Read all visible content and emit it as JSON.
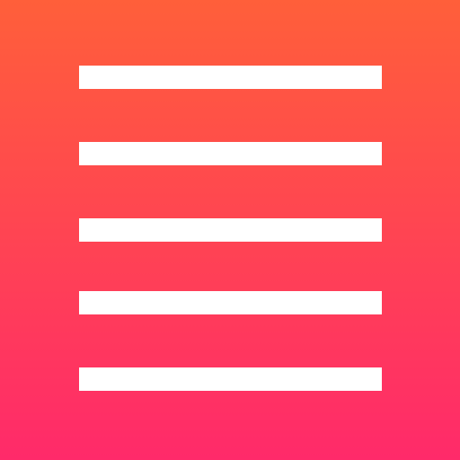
{
  "app_icon": {
    "icon_name": "menu-lines-icon",
    "gradient_top_color": "#FF5F3A",
    "gradient_bottom_color": "#FF2A6A",
    "bar_color": "#FFFFFF",
    "bar_count": 5
  }
}
